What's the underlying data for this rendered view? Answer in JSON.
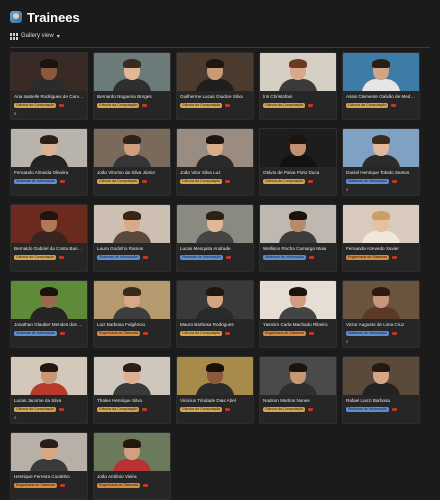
{
  "header": {
    "title": "Trainees"
  },
  "view": {
    "label": "Gallery view"
  },
  "course_colors": {
    "Ciência da Computação": "#d9a54c",
    "Sistemas de Informação": "#5b8fd6",
    "Engenharia de Sistemas": "#d98a3b"
  },
  "trainees": [
    {
      "name": "Ana Isabelle Rodrigues de Carvalho",
      "course": "Ciência da Computação",
      "count": "5",
      "photo": {
        "bg": "#3a2a25",
        "skin": "#8b5a3c",
        "hair": "#1a1210",
        "shirt": "#2b2b2b"
      }
    },
    {
      "name": "Bernardo Nogueira Borges",
      "course": "Ciência da Computação",
      "count": "",
      "photo": {
        "bg": "#6b7b7a",
        "skin": "#e0b896",
        "hair": "#3a2a1e",
        "shirt": "#2e2e2e"
      }
    },
    {
      "name": "Guilherme Lucas Giudice Silva",
      "course": "Ciência da Computação",
      "count": "",
      "photo": {
        "bg": "#4a3b2e",
        "skin": "#c99a78",
        "hair": "#20160f",
        "shirt": "#1f1f1f"
      }
    },
    {
      "name": "Íris Christofani",
      "course": "Ciência da Computação",
      "count": "",
      "photo": {
        "bg": "#d6cfc4",
        "skin": "#d9a88a",
        "hair": "#6b3a1f",
        "shirt": "#3a3a3a"
      }
    },
    {
      "name": "Assis Clemente Galvão de Medeiros",
      "course": "Ciência da Computação",
      "count": "",
      "photo": {
        "bg": "#3e7ca8",
        "skin": "#d4a583",
        "hair": "#2a1d15",
        "shirt": "#e6e6e6"
      }
    },
    {
      "name": "Fernando Almeida Oliveira",
      "course": "Sistemas de Informação",
      "count": "",
      "photo": {
        "bg": "#b9b3ad",
        "skin": "#d8b395",
        "hair": "#2b1f18",
        "shirt": "#232323"
      }
    },
    {
      "name": "João Vitorino da Silva Júnior",
      "course": "Ciência da Computação",
      "count": "",
      "photo": {
        "bg": "#7a6a5c",
        "skin": "#cf9e7c",
        "hair": "#2d2119",
        "shirt": "#353535"
      }
    },
    {
      "name": "João Vitor Silva Luz",
      "course": "Ciência da Computação",
      "count": "",
      "photo": {
        "bg": "#9a8c80",
        "skin": "#d9ad8c",
        "hair": "#1e1510",
        "shirt": "#2a2a2a"
      }
    },
    {
      "name": "Otávio de Paiva Pinto Duca",
      "course": "Ciência da Computação",
      "count": "",
      "photo": {
        "bg": "#1d1d1d",
        "skin": "#c09070",
        "hair": "#1a1410",
        "shirt": "#111111"
      }
    },
    {
      "name": "Daniel Henrique Toledo Santos",
      "course": "Sistemas de Informação",
      "count": "3",
      "photo": {
        "bg": "#7ea1c4",
        "skin": "#e2b898",
        "hair": "#3b2a1e",
        "shirt": "#2b2b2b"
      }
    },
    {
      "name": "Bernaldo Gabriel da Costa Bandeira",
      "course": "Ciência da Computação",
      "count": "",
      "photo": {
        "bg": "#6b2a1e",
        "skin": "#b07a5a",
        "hair": "#20140e",
        "shirt": "#3a2420"
      }
    },
    {
      "name": "Laura Godinho Ramos",
      "course": "Sistemas de Informação",
      "count": "",
      "photo": {
        "bg": "#cdbfb2",
        "skin": "#d8a98a",
        "hair": "#3a2416",
        "shirt": "#5a4a3e"
      }
    },
    {
      "name": "Lucas Mesquita Andrade",
      "course": "Sistemas de Informação",
      "count": "",
      "photo": {
        "bg": "#8a8a80",
        "skin": "#e0b896",
        "hair": "#2c2018",
        "shirt": "#444444"
      }
    },
    {
      "name": "Wellison Rocha Camargo Maia",
      "course": "Sistemas de Informação",
      "count": "",
      "photo": {
        "bg": "#bfb8b0",
        "skin": "#b98a6a",
        "hair": "#1a120c",
        "shirt": "#3c3c3c"
      }
    },
    {
      "name": "Fernanda Azevedo Xavier",
      "course": "Engenharia de Sistemas",
      "count": "",
      "photo": {
        "bg": "#d8cbbd",
        "skin": "#e8c0a0",
        "hair": "#c9a064",
        "shirt": "#efe7dc"
      }
    },
    {
      "name": "Jonathan Glauber Mendes dos Santos",
      "course": "Sistemas de Informação",
      "count": "",
      "photo": {
        "bg": "#5f8a3a",
        "skin": "#9a6a4c",
        "hair": "#1a120c",
        "shirt": "#242424"
      }
    },
    {
      "name": "Luiz Barbosa Fulgêncio",
      "course": "Engenharia de Sistemas",
      "count": "",
      "photo": {
        "bg": "#b59a70",
        "skin": "#d8aa88",
        "hair": "#3a2a1c",
        "shirt": "#3e3e3e"
      }
    },
    {
      "name": "Mauro Barbosa Rodrigues",
      "course": "Ciência da Computação",
      "count": "",
      "photo": {
        "bg": "#3a3a3a",
        "skin": "#d2a482",
        "hair": "#1e1610",
        "shirt": "#2a2a2a"
      }
    },
    {
      "name": "Yasmim Carla Machado Ribeiro",
      "course": "Engenharia de Sistemas",
      "count": "",
      "photo": {
        "bg": "#e6ded4",
        "skin": "#cf9e80",
        "hair": "#1e130c",
        "shirt": "#444444"
      }
    },
    {
      "name": "Victor Augusto de Lima Cruz",
      "course": "Sistemas de Informação",
      "count": "2",
      "photo": {
        "bg": "#6a5440",
        "skin": "#c8967a",
        "hair": "#2a1a10",
        "shirt": "#5a3a26"
      }
    },
    {
      "name": "Lucas Jacome da Silva",
      "course": "Ciência da Computação",
      "count": "2",
      "photo": {
        "bg": "#d4c8ba",
        "skin": "#c89676",
        "hair": "#22160e",
        "shirt": "#b83a2a"
      }
    },
    {
      "name": "Thales Henrique Silva",
      "course": "Ciência da Computação",
      "count": "",
      "photo": {
        "bg": "#cfc7bd",
        "skin": "#dcb090",
        "hair": "#2a1e16",
        "shirt": "#3a3a3a"
      }
    },
    {
      "name": "Vinícius Trindade Dias Abel",
      "course": "Ciência da Computação",
      "count": "",
      "photo": {
        "bg": "#a88a4a",
        "skin": "#8a5a3c",
        "hair": "#1a100a",
        "shirt": "#2b2b2b"
      }
    },
    {
      "name": "Nadson Martins Nunes",
      "course": "Ciência da Computação",
      "count": "",
      "photo": {
        "bg": "#4a4a4a",
        "skin": "#c99676",
        "hair": "#1c130d",
        "shirt": "#2e2e2e"
      }
    },
    {
      "name": "Rafael Lanzi Barbosa",
      "course": "Sistemas de Informação",
      "count": "",
      "photo": {
        "bg": "#5a4a3c",
        "skin": "#d4a686",
        "hair": "#241810",
        "shirt": "#222222"
      }
    },
    {
      "name": "Henrique Ferreira Coutinho",
      "course": "Engenharia de Sistemas",
      "count": "",
      "photo": {
        "bg": "#b8b0a6",
        "skin": "#d6a886",
        "hair": "#2a1e16",
        "shirt": "#3a3a3a"
      }
    },
    {
      "name": "João Antônio Vieira",
      "course": "Engenharia de Sistemas",
      "count": "",
      "photo": {
        "bg": "#6a7a5a",
        "skin": "#d0a080",
        "hair": "#231710",
        "shirt": "#b83232"
      }
    }
  ]
}
